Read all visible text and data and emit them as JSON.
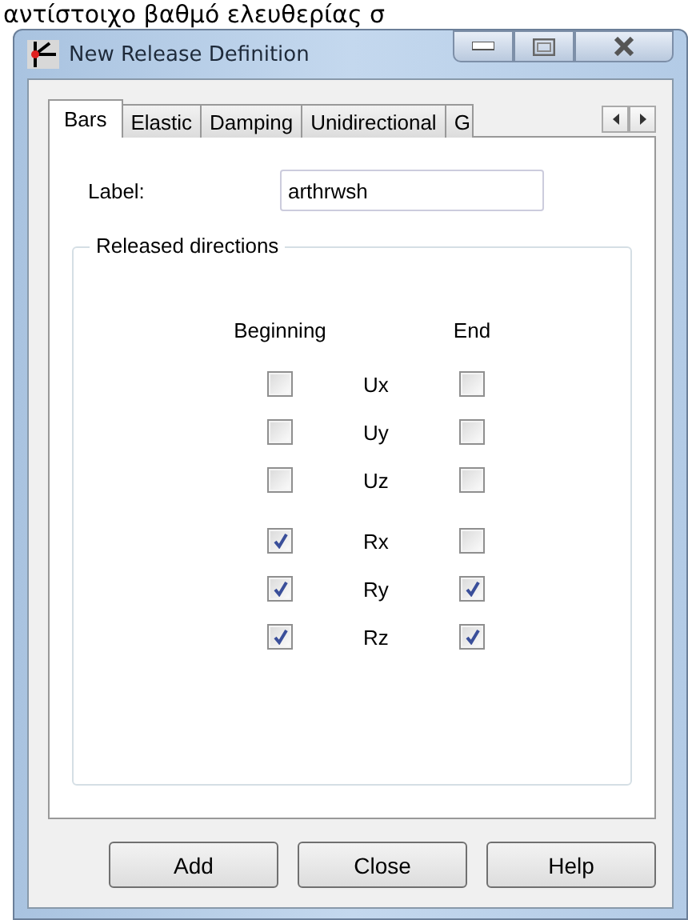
{
  "caption_above": "αντίστοιχο βαθμό ελευθερίας σ",
  "window": {
    "title": "New Release Definition"
  },
  "tabs": [
    {
      "label": "Bars",
      "selected": true
    },
    {
      "label": "Elastic",
      "selected": false
    },
    {
      "label": "Damping",
      "selected": false
    },
    {
      "label": "Unidirectional",
      "selected": false
    },
    {
      "label": "G",
      "selected": false
    }
  ],
  "label_field": {
    "label": "Label:",
    "value": "arthrwsh"
  },
  "group": {
    "title": "Released directions",
    "column_headers": [
      "Beginning",
      "End"
    ],
    "rows": [
      {
        "label": "Ux",
        "beginning": {
          "checked": false
        },
        "end": {
          "checked": false
        }
      },
      {
        "label": "Uy",
        "beginning": {
          "checked": false
        },
        "end": {
          "checked": false
        }
      },
      {
        "label": "Uz",
        "beginning": {
          "checked": false
        },
        "end": {
          "checked": false
        }
      },
      {
        "label": "Rx",
        "beginning": {
          "checked": true
        },
        "end": {
          "checked": false
        }
      },
      {
        "label": "Ry",
        "beginning": {
          "checked": true
        },
        "end": {
          "checked": true
        }
      },
      {
        "label": "Rz",
        "beginning": {
          "checked": true
        },
        "end": {
          "checked": true
        }
      }
    ]
  },
  "buttons": [
    "Add",
    "Close",
    "Help"
  ]
}
